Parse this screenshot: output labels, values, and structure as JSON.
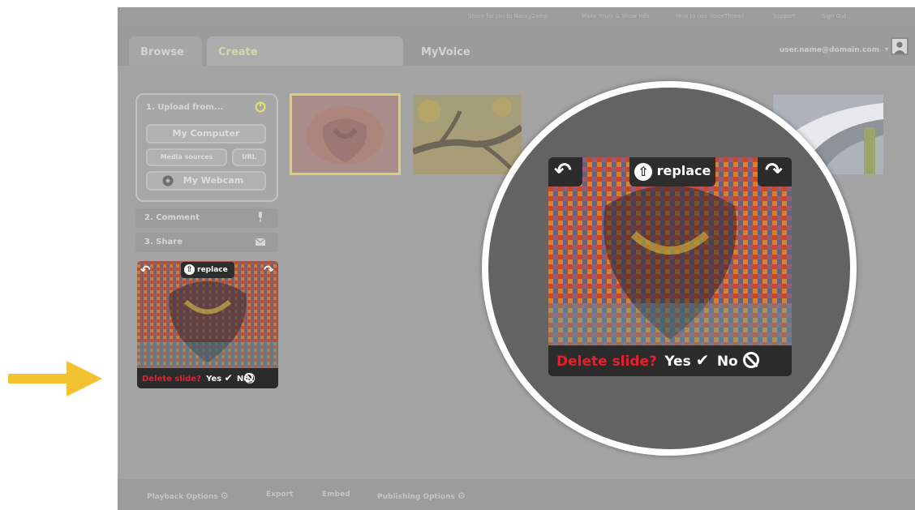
{
  "top_links": [
    "Share for Jan to Nancy2amp",
    "Make Yours & Show Info",
    "How to use VoiceThread",
    "Support",
    "Sign Out"
  ],
  "tabs": {
    "browse": "Browse",
    "create": "Create",
    "myvoice": "MyVoice"
  },
  "user": {
    "email": "user.name@domain.com",
    "caret": "▾"
  },
  "steps": {
    "upload_title": "1. Upload from...",
    "my_computer": "My Computer",
    "media_sources": "Media sources",
    "url": "URL",
    "my_webcam": "My Webcam",
    "comment": "2. Comment",
    "share": "3. Share"
  },
  "slide_card": {
    "replace": "replace",
    "delete_prompt": "Delete slide?",
    "yes": "Yes",
    "no": "No"
  },
  "bottom_bar": {
    "playback": "Playback Options",
    "export": "Export",
    "embed": "Embed",
    "publishing": "Publishing Options"
  },
  "colors": {
    "accent_arrow": "#f2c230",
    "delete_red": "#e4202d",
    "selected_outline": "#d7d27a"
  },
  "icons": [
    "rotate-left-icon",
    "rotate-right-icon",
    "upload-arrow-icon",
    "checkmark-icon",
    "no-sign-icon",
    "webcam-icon",
    "gear-icon",
    "user-avatar-icon"
  ]
}
